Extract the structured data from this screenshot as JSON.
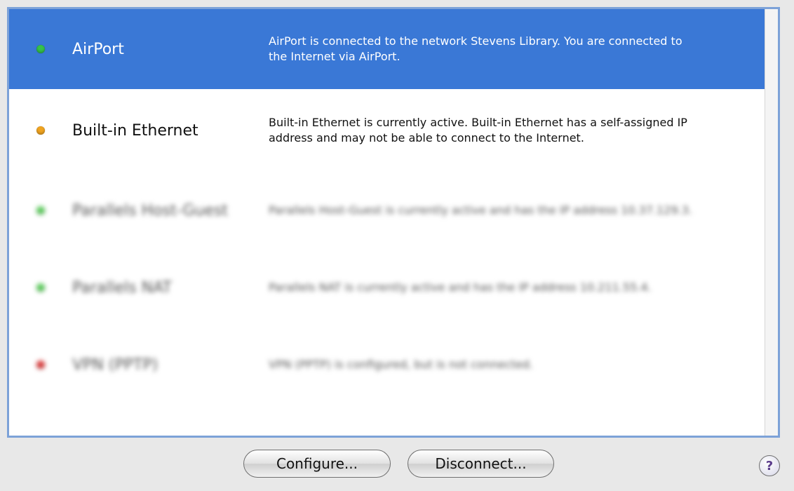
{
  "connections": [
    {
      "name": "AirPort",
      "status_color": "#35c24a",
      "description": "AirPort is connected to the network Stevens Library. You are connected to the Internet via AirPort.",
      "selected": true,
      "blurred": false
    },
    {
      "name": "Built-in Ethernet",
      "status_color": "#f0a420",
      "description": "Built-in Ethernet is currently active. Built-in Ethernet has a self-assigned IP address and may not be able to connect to the Internet.",
      "selected": false,
      "blurred": false
    },
    {
      "name": "Parallels Host-Guest",
      "status_color": "#5bd15b",
      "description": "Parallels Host-Guest is currently active and has the IP address 10.37.129.3.",
      "selected": false,
      "blurred": true
    },
    {
      "name": "Parallels NAT",
      "status_color": "#5bd15b",
      "description": "Parallels NAT is currently active and has the IP address 10.211.55.4.",
      "selected": false,
      "blurred": true
    },
    {
      "name": "VPN (PPTP)",
      "status_color": "#e03a3a",
      "description": "VPN (PPTP) is configured, but is not connected.",
      "selected": false,
      "blurred": true
    }
  ],
  "buttons": {
    "configure": "Configure...",
    "disconnect": "Disconnect..."
  },
  "help": {
    "label": "?"
  }
}
